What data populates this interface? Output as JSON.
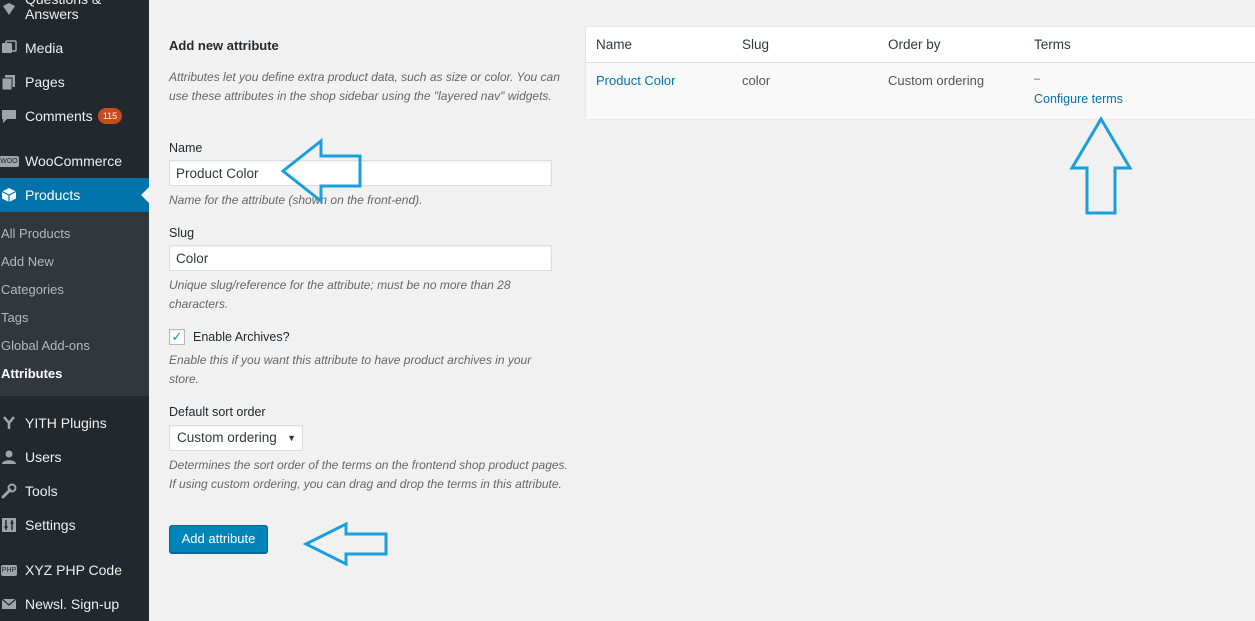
{
  "sidebar": {
    "top_item": "Questions & Answers",
    "menu": [
      {
        "label": "Media",
        "icon": "media-icon"
      },
      {
        "label": "Pages",
        "icon": "pages-icon"
      },
      {
        "label": "Comments",
        "icon": "comments-icon",
        "badge": "115"
      },
      {
        "label": "WooCommerce",
        "icon": "woocommerce-icon",
        "icon_text": "WOO"
      },
      {
        "label": "Products",
        "icon": "products-icon"
      },
      {
        "label": "YITH Plugins",
        "icon": "yith-icon"
      },
      {
        "label": "Users",
        "icon": "users-icon"
      },
      {
        "label": "Tools",
        "icon": "wrench-icon"
      },
      {
        "label": "Settings",
        "icon": "settings-icon"
      },
      {
        "label": "XYZ PHP Code",
        "icon": "php-icon",
        "icon_text": "PHP"
      },
      {
        "label": "Newsl. Sign-up",
        "icon": "mail-icon"
      }
    ],
    "submenu": [
      "All Products",
      "Add New",
      "Categories",
      "Tags",
      "Global Add-ons",
      "Attributes"
    ]
  },
  "form": {
    "heading": "Add new attribute",
    "intro": "Attributes let you define extra product data, such as size or color. You can use these attributes in the shop sidebar using the \"layered nav\" widgets.",
    "name_label": "Name",
    "name_value": "Product Color",
    "name_desc": "Name for the attribute (shown on the front-end).",
    "slug_label": "Slug",
    "slug_value": "Color",
    "slug_desc": "Unique slug/reference for the attribute; must be no more than 28 characters.",
    "archives_label": "Enable Archives?",
    "archives_checked": true,
    "archives_desc": "Enable this if you want this attribute to have product archives in your store.",
    "sort_label": "Default sort order",
    "sort_value": "Custom ordering",
    "sort_desc": "Determines the sort order of the terms on the frontend shop product pages. If using custom ordering, you can drag and drop the terms in this attribute.",
    "submit_label": "Add attribute"
  },
  "table": {
    "headers": [
      "Name",
      "Slug",
      "Order by",
      "Terms"
    ],
    "rows": [
      {
        "name": "Product Color",
        "slug": "color",
        "order_by": "Custom ordering",
        "terms": "–",
        "configure": "Configure terms"
      }
    ]
  },
  "colors": {
    "accent": "#0073aa",
    "sidebar_bg": "#23282d",
    "annotation_arrow": "#1a9fdc",
    "badge": "#ca4a1f"
  }
}
